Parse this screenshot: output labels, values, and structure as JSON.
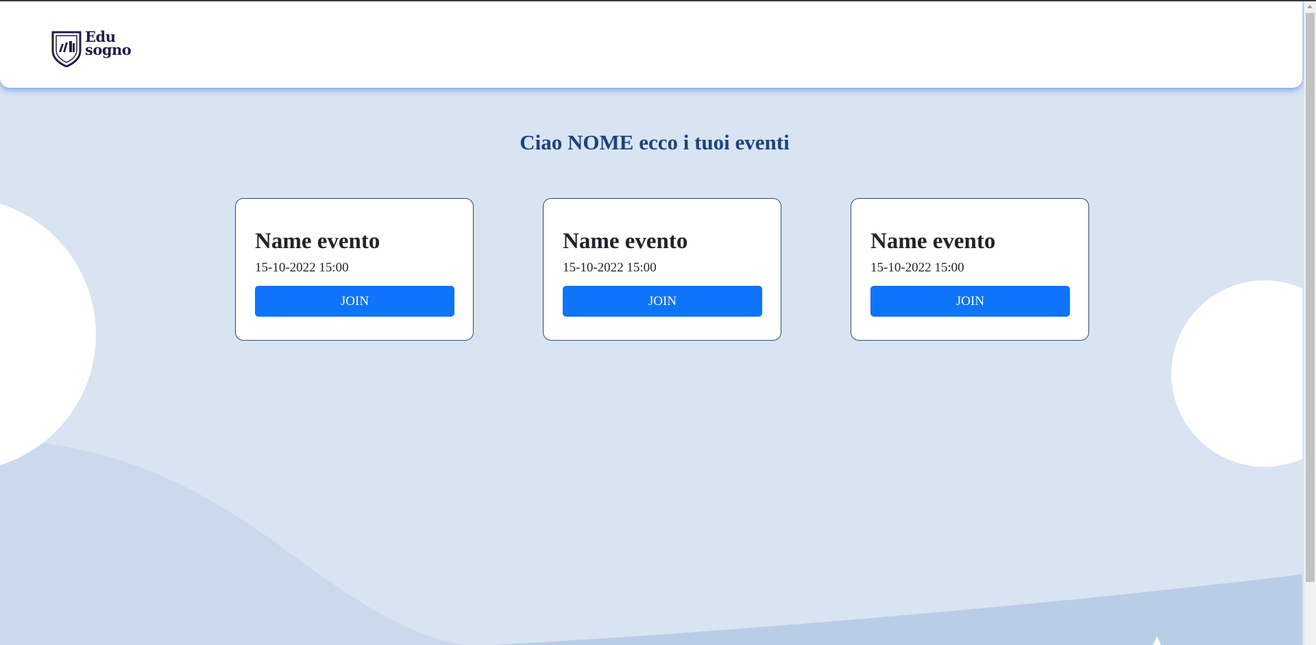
{
  "brand": {
    "logo_line1": "Edu",
    "logo_line2": "sogno",
    "logo_icon": "shield-books-icon",
    "text_color": "#1f1d4a"
  },
  "main": {
    "greeting": "Ciao NOME ecco i tuoi eventi",
    "greeting_color": "#1a4380"
  },
  "events": [
    {
      "title": "Name evento",
      "datetime": "15-10-2022 15:00",
      "button_label": "JOIN"
    },
    {
      "title": "Name evento",
      "datetime": "15-10-2022 15:00",
      "button_label": "JOIN"
    },
    {
      "title": "Name evento",
      "datetime": "15-10-2022 15:00",
      "button_label": "JOIN"
    }
  ],
  "colors": {
    "background": "#d9e4f3",
    "button": "#0d74fb",
    "card_border": "#2a4a80"
  }
}
